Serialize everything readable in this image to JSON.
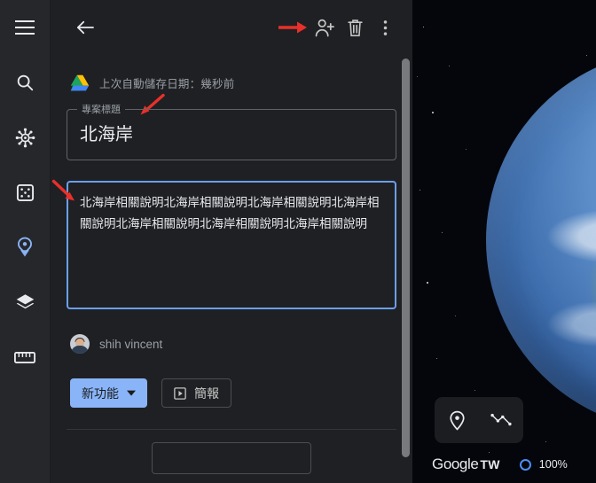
{
  "app": {
    "name": "Google Earth",
    "accent_blue": "#8ab4f8",
    "focus_blue": "#6b9ff0",
    "panel_bg": "#1f2023",
    "rail_bg": "#26272b",
    "annotation_color": "#e8302a"
  },
  "rail": {
    "items": [
      {
        "icon": "hamburger-menu-icon",
        "name": "menu"
      },
      {
        "icon": "search-icon",
        "name": "search"
      },
      {
        "icon": "ship-wheel-icon",
        "name": "voyager"
      },
      {
        "icon": "dice-icon",
        "name": "feeling-lucky"
      },
      {
        "icon": "map-pin-icon",
        "name": "projects",
        "active": true
      },
      {
        "icon": "layers-icon",
        "name": "map-style"
      },
      {
        "icon": "ruler-icon",
        "name": "measure"
      }
    ]
  },
  "panel": {
    "toolbar": {
      "back_icon": "back-arrow-icon",
      "share_icon": "person-add-icon",
      "delete_icon": "trash-icon",
      "more_icon": "more-vertical-icon"
    },
    "drive_status": {
      "icon": "google-drive-icon",
      "text": "上次自動儲存日期：幾秒前"
    },
    "title_field": {
      "label": "專案標題",
      "value": "北海岸"
    },
    "description_field": {
      "value": "北海岸相關說明北海岸相關說明北海岸相關說明北海岸相關說明北海岸相關說明北海岸相關說明北海岸相關說明",
      "focused": true
    },
    "owner": {
      "name": "shih vincent",
      "avatar": "user-avatar"
    },
    "buttons": {
      "new_feature": "新功能",
      "new_feature_caret": "chevron-down-icon",
      "presentation": "簡報",
      "presentation_icon": "play-box-icon"
    },
    "scrollbar": "vertical-scrollbar"
  },
  "globe": {
    "controls": [
      {
        "icon": "placemark-pin-icon",
        "name": "add-placemark"
      },
      {
        "icon": "path-line-icon",
        "name": "draw-path"
      }
    ],
    "branding": {
      "logo": "Google",
      "region": "TW"
    },
    "loading": {
      "indicator": "loading-ring",
      "percent": "100%"
    }
  },
  "annotations": [
    {
      "name": "arrow-to-share-button",
      "direction": "right"
    },
    {
      "name": "arrow-to-title-label",
      "direction": "down-left"
    },
    {
      "name": "arrow-to-description-box",
      "direction": "down-right"
    }
  ]
}
